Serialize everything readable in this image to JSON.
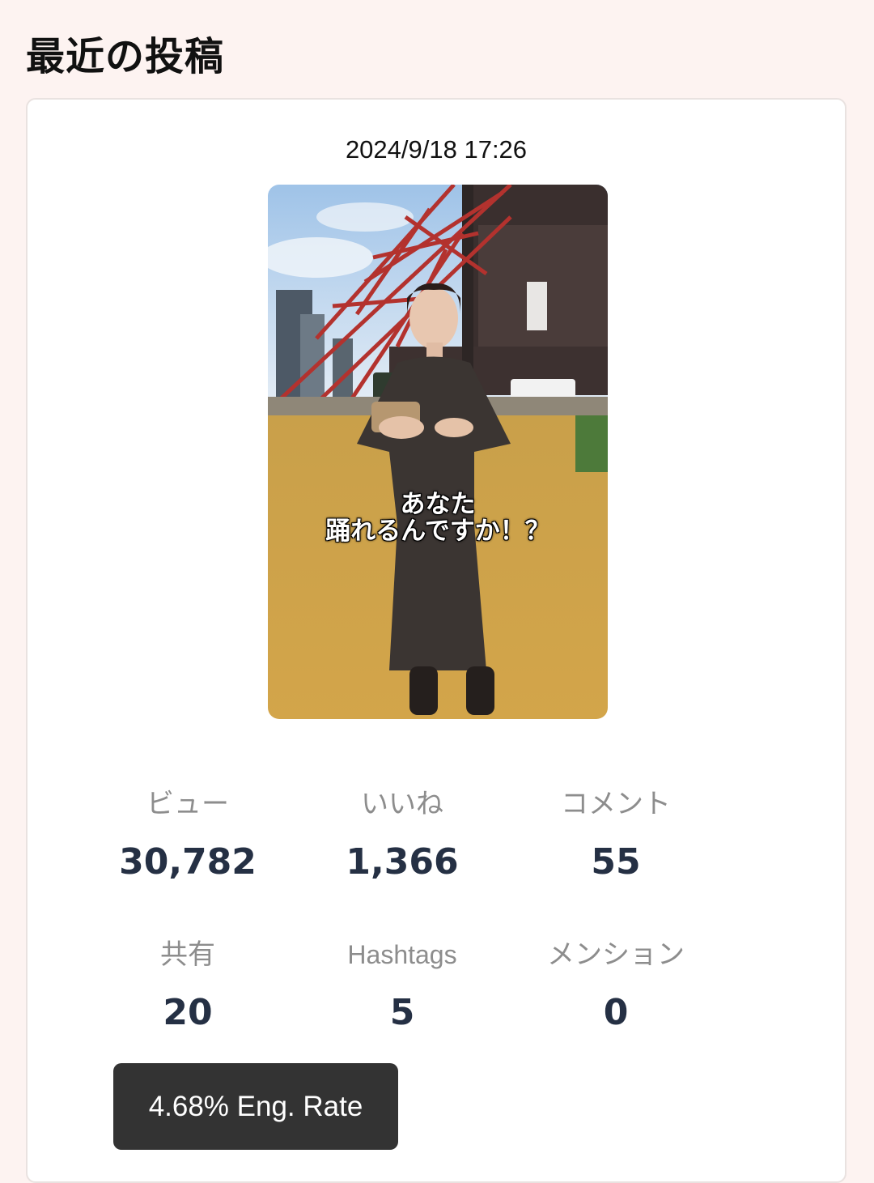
{
  "header": {
    "title": "最近の投稿"
  },
  "post": {
    "date": "2024/9/18 17:26",
    "caption_line1": "あなた",
    "caption_line2": "踊れるんですか！？"
  },
  "stats": {
    "views": {
      "label": "ビュー",
      "value": "30,782"
    },
    "likes": {
      "label": "いいね",
      "value": "1,366"
    },
    "comments": {
      "label": "コメント",
      "value": "55"
    },
    "shares": {
      "label": "共有",
      "value": "20"
    },
    "hashtags": {
      "label": "Hashtags",
      "value": "5"
    },
    "mentions": {
      "label": "メンション",
      "value": "0"
    }
  },
  "engagement": {
    "label": "4.68% Eng. Rate"
  },
  "colors": {
    "background": "#fdf3f1",
    "stat_value": "#253044",
    "stat_label": "#8d8d8d",
    "badge": "#333333"
  }
}
